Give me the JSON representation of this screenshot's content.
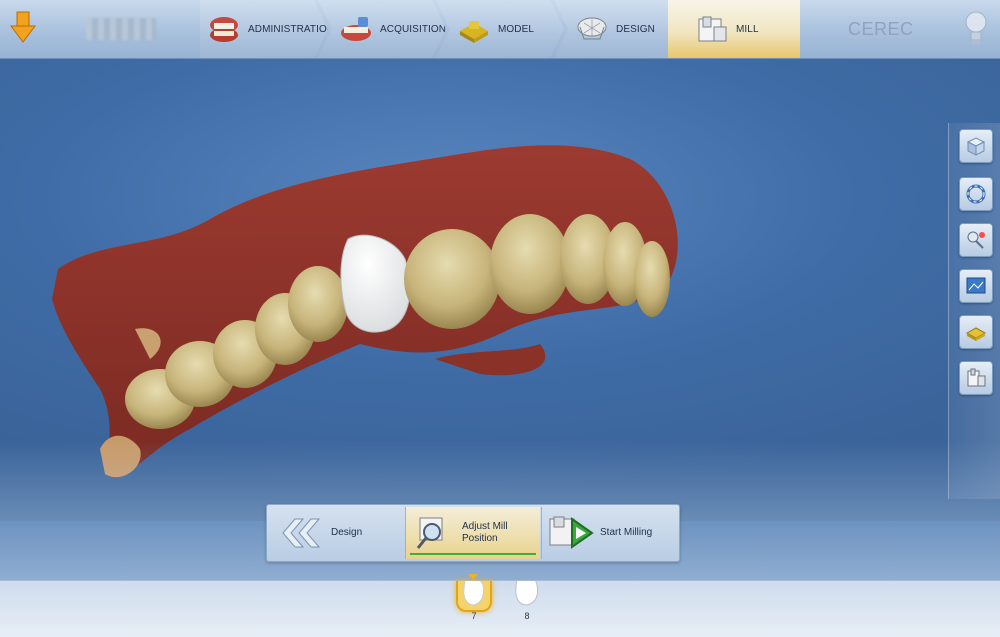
{
  "app": {
    "brand": "CEREC"
  },
  "phases": [
    {
      "label": "ADMINISTRATION",
      "icon": "administration-teeth-icon"
    },
    {
      "label": "ACQUISITION",
      "icon": "acquisition-camera-icon"
    },
    {
      "label": "MODEL",
      "icon": "model-block-icon"
    },
    {
      "label": "DESIGN",
      "icon": "design-crown-icon"
    },
    {
      "label": "MILL",
      "icon": "mill-unit-icon",
      "active": true
    }
  ],
  "actions": {
    "back_label": "Design",
    "adjust_label_line1": "Adjust Mill",
    "adjust_label_line2": "Position",
    "start_label": "Start Milling"
  },
  "restorations": [
    {
      "number": "7",
      "active": true
    },
    {
      "number": "8",
      "active": false
    }
  ],
  "colors": {
    "accent": "#e7c66e",
    "progress": "#3fae3f",
    "viewport_bg": "#3f6ca6"
  }
}
